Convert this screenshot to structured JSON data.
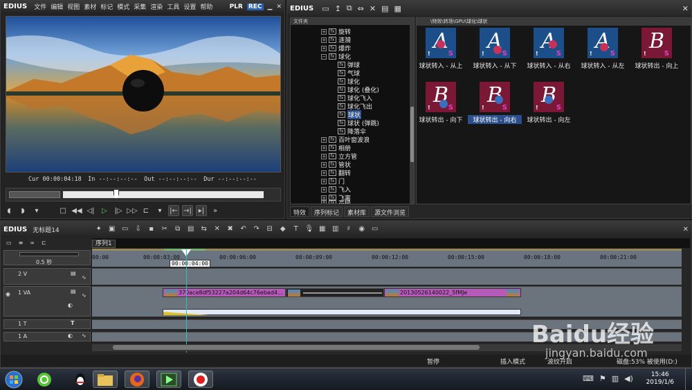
{
  "player": {
    "app_name": "EDIUS",
    "menu": [
      "文件",
      "编辑",
      "视图",
      "素材",
      "标记",
      "模式",
      "采集",
      "渲染",
      "工具",
      "设置",
      "帮助"
    ],
    "plr_label": "PLR",
    "rec_label": "REC",
    "timecodes": [
      {
        "label": "Cur",
        "value": "00:00:04:18"
      },
      {
        "label": "In",
        "value": "--:--:--:--"
      },
      {
        "label": "Out",
        "value": "--:--:--:--"
      },
      {
        "label": "Dur",
        "value": "--:--:--:--"
      }
    ]
  },
  "effects": {
    "app_name": "EDIUS",
    "tree_header": "文件夹",
    "tree_items": [
      {
        "label": "旋转",
        "expanded": false
      },
      {
        "label": "涟漪",
        "expanded": false
      },
      {
        "label": "爆炸",
        "expanded": false
      },
      {
        "label": "球化",
        "expanded": true
      },
      {
        "label": "弹球",
        "child": true
      },
      {
        "label": "气球",
        "child": true
      },
      {
        "label": "球化",
        "child": true
      },
      {
        "label": "球化 (叠化)",
        "child": true
      },
      {
        "label": "球化飞入",
        "child": true
      },
      {
        "label": "球化飞出",
        "child": true
      },
      {
        "label": "球状",
        "child": true,
        "selected": true
      },
      {
        "label": "球状 (弹跳)",
        "child": true
      },
      {
        "label": "降落伞",
        "child": true
      },
      {
        "label": "百叶窗波浪",
        "expanded": false
      },
      {
        "label": "相册",
        "expanded": false
      },
      {
        "label": "立方管",
        "expanded": false
      },
      {
        "label": "管状",
        "expanded": false
      },
      {
        "label": "翻转",
        "expanded": false
      },
      {
        "label": "门",
        "expanded": false
      },
      {
        "label": "飞入",
        "expanded": false
      },
      {
        "label": "飞离",
        "expanded": false
      },
      {
        "label": "高级",
        "expanded": false
      }
    ],
    "path": "\\特效\\转场\\GPU\\球化\\球状",
    "thumbnails": [
      {
        "letter": "A",
        "caption": "球状转入 - 从上"
      },
      {
        "letter": "A",
        "caption": "球状转入 - 从下"
      },
      {
        "letter": "A",
        "caption": "球状转入 - 从右"
      },
      {
        "letter": "A",
        "caption": "球状转入 - 从左"
      },
      {
        "letter": "B",
        "caption": "球状转出 - 向上"
      },
      {
        "letter": "B",
        "caption": "球状转出 - 向下"
      },
      {
        "letter": "B",
        "caption": "球状转出 - 向右",
        "selected": true
      },
      {
        "letter": "B",
        "caption": "球状转出 - 向左"
      }
    ],
    "tabs": [
      "特效",
      "序列标记",
      "素材库",
      "源文件浏览"
    ]
  },
  "timeline": {
    "app_name": "EDIUS",
    "project_name": "无标题14",
    "sequence_tab": "序列1",
    "zoom_label": "0.5 秒",
    "playhead_time": "00:00:04:00",
    "ruler_ticks": [
      "00:00",
      "00:00:03:00",
      "00:00:06:00",
      "00:00:09:00",
      "00:00:12:00",
      "00:00:15:00",
      "00:00:18:00",
      "00:00:21:00"
    ],
    "tracks": [
      {
        "name": "2 V"
      },
      {
        "name": "1 VA"
      },
      {
        "name": "1 T"
      },
      {
        "name": "1 A"
      }
    ],
    "clips": [
      {
        "label": "370ace8df53227a204d64c76ebad4..."
      },
      {
        "label": "20130526140022_5fMJe"
      }
    ],
    "status": [
      "暂停",
      "插入模式",
      "波纹开启",
      "磁盘:53% 被使用(D:)"
    ]
  },
  "taskbar": {
    "time": "15:46",
    "date": "2019/1/6"
  },
  "watermark": {
    "text": "Baidu经验",
    "url": "jingyan.baidu.com"
  },
  "colors": {
    "accent_selected": "#2b4f8a",
    "clip": "#b55ab8",
    "playhead": "#2ec0c0",
    "tile_A": "#1c4e8a",
    "tile_B": "#7a1836"
  }
}
